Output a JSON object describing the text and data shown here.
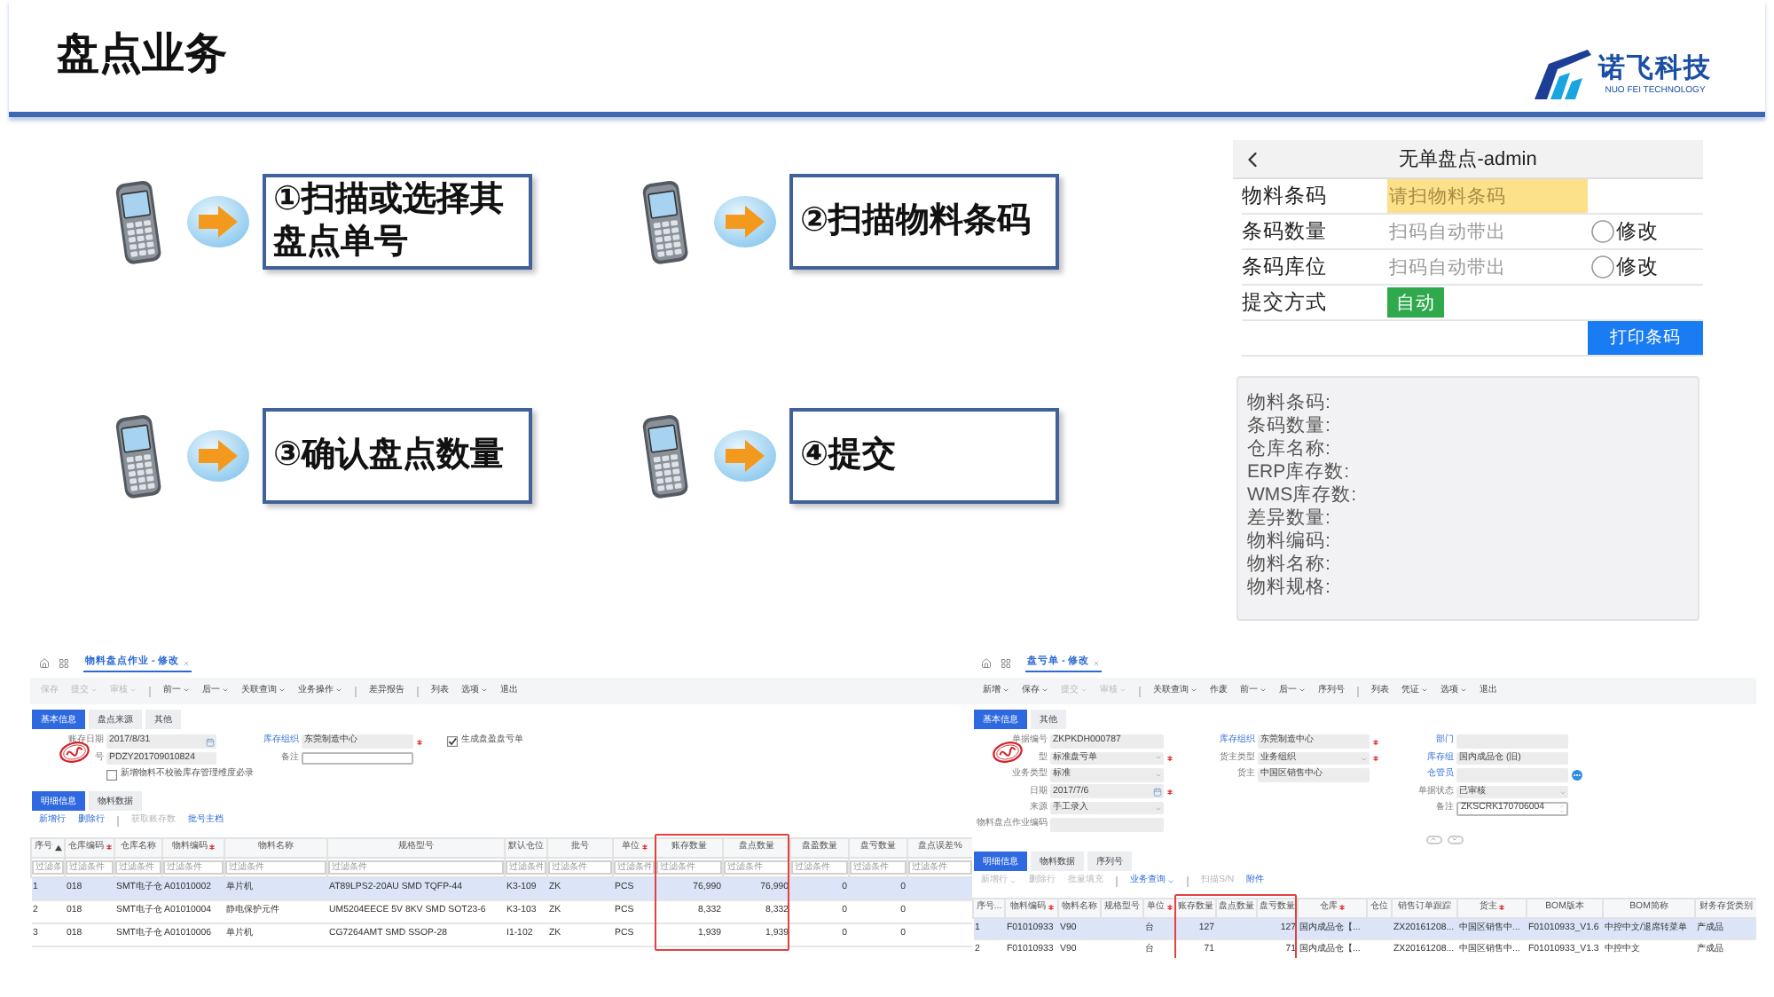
{
  "header": {
    "title": "盘点业务",
    "logo": {
      "name": "诺飞科技",
      "tagline": "NUO FEI TECHNOLOGY"
    }
  },
  "steps": [
    {
      "text": "①扫描或选择其盘点单号"
    },
    {
      "text": "②扫描物料条码"
    },
    {
      "text": "③确认盘点数量"
    },
    {
      "text": "④提交"
    }
  ],
  "phone": {
    "title": "无单盘点-admin",
    "rows": [
      {
        "kind": "field",
        "label": "物料条码",
        "placeholder": "请扫物料条码",
        "highlighted": true
      },
      {
        "kind": "field",
        "label": "条码数量",
        "placeholder": "扫码自动带出",
        "highlighted": false,
        "option": {
          "label": "修改",
          "checked": false
        }
      },
      {
        "kind": "field",
        "label": "条码库位",
        "placeholder": "扫码自动带出",
        "highlighted": false,
        "option": {
          "label": "修改",
          "checked": false
        }
      },
      {
        "kind": "mode",
        "label": "提交方式",
        "value": "自动"
      }
    ],
    "print_button": "打印条码",
    "info_lines": [
      "物料条码:",
      "条码数量:",
      "仓库名称:",
      "ERP库存数:",
      "WMS库存数:",
      "差异数量:",
      "物料编码:",
      "物料名称:",
      "物料规格:"
    ]
  },
  "screens": [
    {
      "tab": "物料盘点作业 - 修改",
      "toolbar": [
        {
          "kind": "button",
          "label": "保存",
          "disabled": true,
          "dropdown": false
        },
        {
          "kind": "button",
          "label": "提交",
          "disabled": true,
          "dropdown": true
        },
        {
          "kind": "button",
          "label": "审核",
          "disabled": true,
          "dropdown": true
        },
        {
          "kind": "divider"
        },
        {
          "kind": "button",
          "label": "前一",
          "disabled": false,
          "dropdown": true
        },
        {
          "kind": "button",
          "label": "后一",
          "disabled": false,
          "dropdown": true
        },
        {
          "kind": "button",
          "label": "关联查询",
          "disabled": false,
          "dropdown": true
        },
        {
          "kind": "button",
          "label": "业务操作",
          "disabled": false,
          "dropdown": true
        },
        {
          "kind": "divider"
        },
        {
          "kind": "button",
          "label": "差异报告",
          "disabled": false,
          "dropdown": false
        },
        {
          "kind": "divider"
        },
        {
          "kind": "button",
          "label": "列表",
          "disabled": false,
          "dropdown": false
        },
        {
          "kind": "button",
          "label": "选项",
          "disabled": false,
          "dropdown": true
        },
        {
          "kind": "button",
          "label": "退出",
          "disabled": false,
          "dropdown": false
        }
      ],
      "form_tabs": [
        {
          "label": "基本信息",
          "selected": true
        },
        {
          "label": "盘点来源",
          "selected": false
        },
        {
          "label": "其他",
          "selected": false
        }
      ],
      "stamped": true,
      "form": [
        [
          {
            "kind": "date",
            "label": "账存日期",
            "value": "2017/8/31",
            "required": false,
            "link": false
          },
          {
            "kind": "text",
            "label": "号",
            "value": "PDZY201709010824",
            "required": false,
            "link": false
          },
          {
            "kind": "checkbox",
            "text": "新增物料不校验库存管理维度必录",
            "checked": false
          }
        ],
        [
          {
            "kind": "text",
            "label": "库存组织",
            "value": "东莞制造中心",
            "required": true,
            "link": true
          },
          {
            "kind": "input",
            "label": "备注",
            "required": false,
            "link": false
          }
        ],
        [
          {
            "kind": "checkbox",
            "text": "生成盘盈盘亏单",
            "checked": true
          }
        ]
      ],
      "detail_tabs": [
        {
          "label": "明细信息",
          "selected": true
        },
        {
          "label": "物料数据",
          "selected": false
        }
      ],
      "detail_toolbar": [
        {
          "kind": "button",
          "label": "新增行",
          "disabled": false,
          "dropdown": false
        },
        {
          "kind": "button",
          "label": "删除行",
          "disabled": false,
          "dropdown": false
        },
        {
          "kind": "divider"
        },
        {
          "kind": "button",
          "label": "获取账存数",
          "disabled": true,
          "dropdown": false
        },
        {
          "kind": "button",
          "label": "批号主档",
          "disabled": false,
          "dropdown": false
        }
      ],
      "table": {
        "columns": [
          {
            "label": "序号",
            "required": false,
            "sorted": true,
            "highlighted": false
          },
          {
            "label": "仓库编码",
            "required": true,
            "sorted": false,
            "highlighted": false
          },
          {
            "label": "仓库名称",
            "required": false,
            "sorted": false,
            "highlighted": false
          },
          {
            "label": "物料编码",
            "required": true,
            "sorted": false,
            "highlighted": false
          },
          {
            "label": "物料名称",
            "required": false,
            "sorted": false,
            "highlighted": false
          },
          {
            "label": "规格型号",
            "required": false,
            "sorted": false,
            "highlighted": false
          },
          {
            "label": "默认仓位",
            "required": false,
            "sorted": false,
            "highlighted": false
          },
          {
            "label": "批号",
            "required": false,
            "sorted": false,
            "highlighted": false
          },
          {
            "label": "单位",
            "required": true,
            "sorted": false,
            "highlighted": false
          },
          {
            "label": "账存数量",
            "required": false,
            "sorted": false,
            "highlighted": true
          },
          {
            "label": "盘点数量",
            "required": false,
            "sorted": false,
            "highlighted": true
          },
          {
            "label": "盘盈数量",
            "required": false,
            "sorted": false,
            "highlighted": false
          },
          {
            "label": "盘亏数量",
            "required": false,
            "sorted": false,
            "highlighted": false
          },
          {
            "label": "盘点误差%",
            "required": false,
            "sorted": false,
            "highlighted": false
          }
        ],
        "filters": [
          {
            "placeholder": "过滤条"
          },
          {
            "placeholder": "过滤条件"
          },
          {
            "placeholder": "过滤条件"
          },
          {
            "placeholder": "过滤条件"
          },
          {
            "placeholder": "过滤条件"
          },
          {
            "placeholder": "过滤条件"
          },
          {
            "placeholder": "过滤条件"
          },
          {
            "placeholder": "过滤条件"
          },
          {
            "placeholder": "过滤条件"
          },
          {
            "placeholder": "过滤条件"
          },
          {
            "placeholder": "过滤条件"
          },
          {
            "placeholder": "过滤条件"
          },
          {
            "placeholder": "过滤条件"
          },
          {
            "placeholder": "过滤条件"
          }
        ],
        "rows": [
          {
            "selected": true,
            "cells": [
              "1",
              "018",
              "SMT电子仓",
              "A01010002",
              "单片机",
              "AT89LPS2-20AU SMD TQFP-44",
              "K3-109",
              "ZK",
              "PCS",
              "76,990",
              "76,990",
              "0",
              "0",
              null
            ]
          },
          {
            "selected": false,
            "cells": [
              "2",
              "018",
              "SMT电子仓",
              "A01010004",
              "静电保护元件",
              "UM5204EECE 5V 8KV SMD SOT23-6",
              "K3-103",
              "ZK",
              "PCS",
              "8,332",
              "8,332",
              "0",
              "0",
              null
            ]
          },
          {
            "selected": false,
            "cells": [
              "3",
              "018",
              "SMT电子仓",
              "A01010006",
              "单片机",
              "CG7264AMT SMD SSOP-28",
              "I1-102",
              "ZK",
              "PCS",
              "1,939",
              "1,939",
              "0",
              "0",
              null
            ]
          }
        ]
      }
    },
    {
      "tab": "盘亏单 - 修改",
      "toolbar": [
        {
          "kind": "button",
          "label": "新增",
          "disabled": false,
          "dropdown": true
        },
        {
          "kind": "button",
          "label": "保存",
          "disabled": false,
          "dropdown": true
        },
        {
          "kind": "button",
          "label": "提交",
          "disabled": true,
          "dropdown": true
        },
        {
          "kind": "button",
          "label": "审核",
          "disabled": true,
          "dropdown": true
        },
        {
          "kind": "divider"
        },
        {
          "kind": "button",
          "label": "关联查询",
          "disabled": false,
          "dropdown": true
        },
        {
          "kind": "button",
          "label": "作废",
          "disabled": false,
          "dropdown": false
        },
        {
          "kind": "button",
          "label": "前一",
          "disabled": false,
          "dropdown": true
        },
        {
          "kind": "button",
          "label": "后一",
          "disabled": false,
          "dropdown": true
        },
        {
          "kind": "button",
          "label": "序列号",
          "disabled": false,
          "dropdown": false
        },
        {
          "kind": "divider"
        },
        {
          "kind": "button",
          "label": "列表",
          "disabled": false,
          "dropdown": false
        },
        {
          "kind": "button",
          "label": "凭证",
          "disabled": false,
          "dropdown": true
        },
        {
          "kind": "button",
          "label": "选项",
          "disabled": false,
          "dropdown": true
        },
        {
          "kind": "button",
          "label": "退出",
          "disabled": false,
          "dropdown": false
        }
      ],
      "form_tabs": [
        {
          "label": "基本信息",
          "selected": true
        },
        {
          "label": "其他",
          "selected": false
        }
      ],
      "stamped": true,
      "form": [
        [
          {
            "kind": "text",
            "label": "单据编号",
            "value": "ZKPKDH000787",
            "required": false,
            "link": false
          },
          {
            "kind": "select",
            "label": "型",
            "value": "标准盘亏单",
            "required": true,
            "link": false
          },
          {
            "kind": "select",
            "label": "业务类型",
            "value": "标准",
            "required": false,
            "link": false
          },
          {
            "kind": "date",
            "label": "日期",
            "value": "2017/7/6",
            "required": true,
            "link": false
          },
          {
            "kind": "select",
            "label": "来源",
            "value": "手工录入",
            "required": false,
            "link": false
          },
          {
            "kind": "text",
            "label": "物料盘点作业编码",
            "required": false,
            "link": false
          }
        ],
        [
          {
            "kind": "text",
            "label": "库存组织",
            "value": "东莞制造中心",
            "required": true,
            "link": true
          },
          {
            "kind": "select",
            "label": "货主类型",
            "value": "业务组织",
            "required": true,
            "link": false
          },
          {
            "kind": "text",
            "label": "货主",
            "value": "中国区销售中心",
            "required": false,
            "link": false
          }
        ],
        [
          {
            "kind": "text",
            "label": "部门",
            "required": false,
            "link": true
          },
          {
            "kind": "text",
            "label": "库存组",
            "value": "国内成品仓 (旧)",
            "required": false,
            "link": true
          },
          {
            "kind": "lookup",
            "label": "仓管员",
            "required": false,
            "link": true
          },
          {
            "kind": "select",
            "label": "单据状态",
            "value": "已审核",
            "required": false,
            "link": false
          },
          {
            "kind": "spinner",
            "label": "备注",
            "value": "ZKSCRK170706004",
            "required": false,
            "link": false
          }
        ]
      ],
      "collapse_bar": true,
      "detail_tabs": [
        {
          "label": "明细信息",
          "selected": true
        },
        {
          "label": "物料数据",
          "selected": false
        },
        {
          "label": "序列号",
          "selected": false
        }
      ],
      "detail_toolbar": [
        {
          "kind": "button",
          "label": "新增行",
          "disabled": true,
          "dropdown": true
        },
        {
          "kind": "button",
          "label": "删除行",
          "disabled": true,
          "dropdown": false
        },
        {
          "kind": "button",
          "label": "批量填充",
          "disabled": true,
          "dropdown": false
        },
        {
          "kind": "divider"
        },
        {
          "kind": "button",
          "label": "业务查询",
          "disabled": false,
          "dropdown": true
        },
        {
          "kind": "divider"
        },
        {
          "kind": "button",
          "label": "扫描S/N",
          "disabled": true,
          "dropdown": false
        },
        {
          "kind": "button",
          "label": "附件",
          "disabled": false,
          "dropdown": false
        }
      ],
      "table": {
        "columns": [
          {
            "label": "序号...",
            "required": false,
            "sorted": false,
            "highlighted": false
          },
          {
            "label": "物料编码",
            "required": true,
            "sorted": false,
            "highlighted": false
          },
          {
            "label": "物料名称",
            "required": false,
            "sorted": false,
            "highlighted": false
          },
          {
            "label": "规格型号",
            "required": false,
            "sorted": false,
            "highlighted": false
          },
          {
            "label": "单位",
            "required": true,
            "sorted": false,
            "highlighted": false
          },
          {
            "label": "账存数量",
            "required": false,
            "sorted": false,
            "highlighted": true
          },
          {
            "label": "盘点数量",
            "required": false,
            "sorted": false,
            "highlighted": true
          },
          {
            "label": "盘亏数量",
            "required": false,
            "sorted": false,
            "highlighted": true
          },
          {
            "label": "仓库",
            "required": true,
            "sorted": false,
            "highlighted": false
          },
          {
            "label": "仓位",
            "required": false,
            "sorted": false,
            "highlighted": false
          },
          {
            "label": "销售订单跟踪",
            "required": false,
            "sorted": false,
            "highlighted": false
          },
          {
            "label": "货主",
            "required": true,
            "sorted": false,
            "highlighted": false
          },
          {
            "label": "BOM版本",
            "required": false,
            "sorted": false,
            "highlighted": false
          },
          {
            "label": "BOM简称",
            "required": false,
            "sorted": false,
            "highlighted": false
          },
          {
            "label": "财务存货类别",
            "required": false,
            "sorted": false,
            "highlighted": false
          }
        ],
        "rows": [
          {
            "selected": true,
            "cells": [
              "1",
              "F01010933",
              "V90",
              null,
              "台",
              "127",
              null,
              "127",
              "国内成品仓【...",
              null,
              "ZX20161208...",
              "中国区销售中...",
              "F01010933_V1.6",
              "中控中文/退席转菜单",
              "产成品"
            ]
          },
          {
            "selected": false,
            "cells": [
              "2",
              "F01010933",
              "V90",
              null,
              "台",
              "71",
              null,
              "71",
              "国内成品仓【...",
              null,
              "ZX20161208...",
              "中国区销售中...",
              "F01010933_V1.3",
              "中控中文",
              "产成品"
            ]
          }
        ]
      }
    }
  ]
}
